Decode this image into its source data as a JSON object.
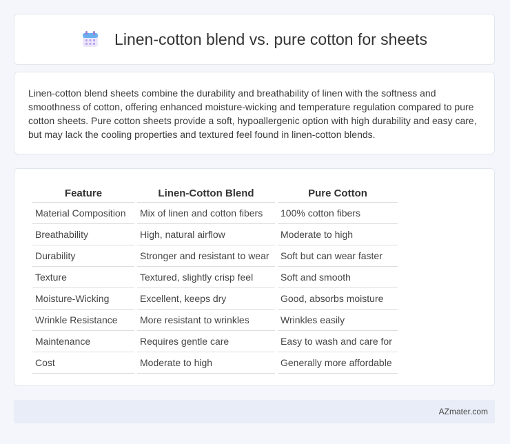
{
  "header": {
    "title": "Linen-cotton blend vs. pure cotton for sheets",
    "icon": "calendar-icon"
  },
  "description": "Linen-cotton blend sheets combine the durability and breathability of linen with the softness and smoothness of cotton, offering enhanced moisture-wicking and temperature regulation compared to pure cotton sheets. Pure cotton sheets provide a soft, hypoallergenic option with high durability and easy care, but may lack the cooling properties and textured feel found in linen-cotton blends.",
  "table": {
    "headers": [
      "Feature",
      "Linen-Cotton Blend",
      "Pure Cotton"
    ],
    "rows": [
      [
        "Material Composition",
        "Mix of linen and cotton fibers",
        "100% cotton fibers"
      ],
      [
        "Breathability",
        "High, natural airflow",
        "Moderate to high"
      ],
      [
        "Durability",
        "Stronger and resistant to wear",
        "Soft but can wear faster"
      ],
      [
        "Texture",
        "Textured, slightly crisp feel",
        "Soft and smooth"
      ],
      [
        "Moisture-Wicking",
        "Excellent, keeps dry",
        "Good, absorbs moisture"
      ],
      [
        "Wrinkle Resistance",
        "More resistant to wrinkles",
        "Wrinkles easily"
      ],
      [
        "Maintenance",
        "Requires gentle care",
        "Easy to wash and care for"
      ],
      [
        "Cost",
        "Moderate to high",
        "Generally more affordable"
      ]
    ]
  },
  "footer": {
    "brand": "AZmater.com"
  },
  "colors": {
    "page_bg": "#f4f6fb",
    "footer_bg": "#e8edf7",
    "icon_purple": "#9b7fd6",
    "icon_blue": "#6ab0f0"
  }
}
